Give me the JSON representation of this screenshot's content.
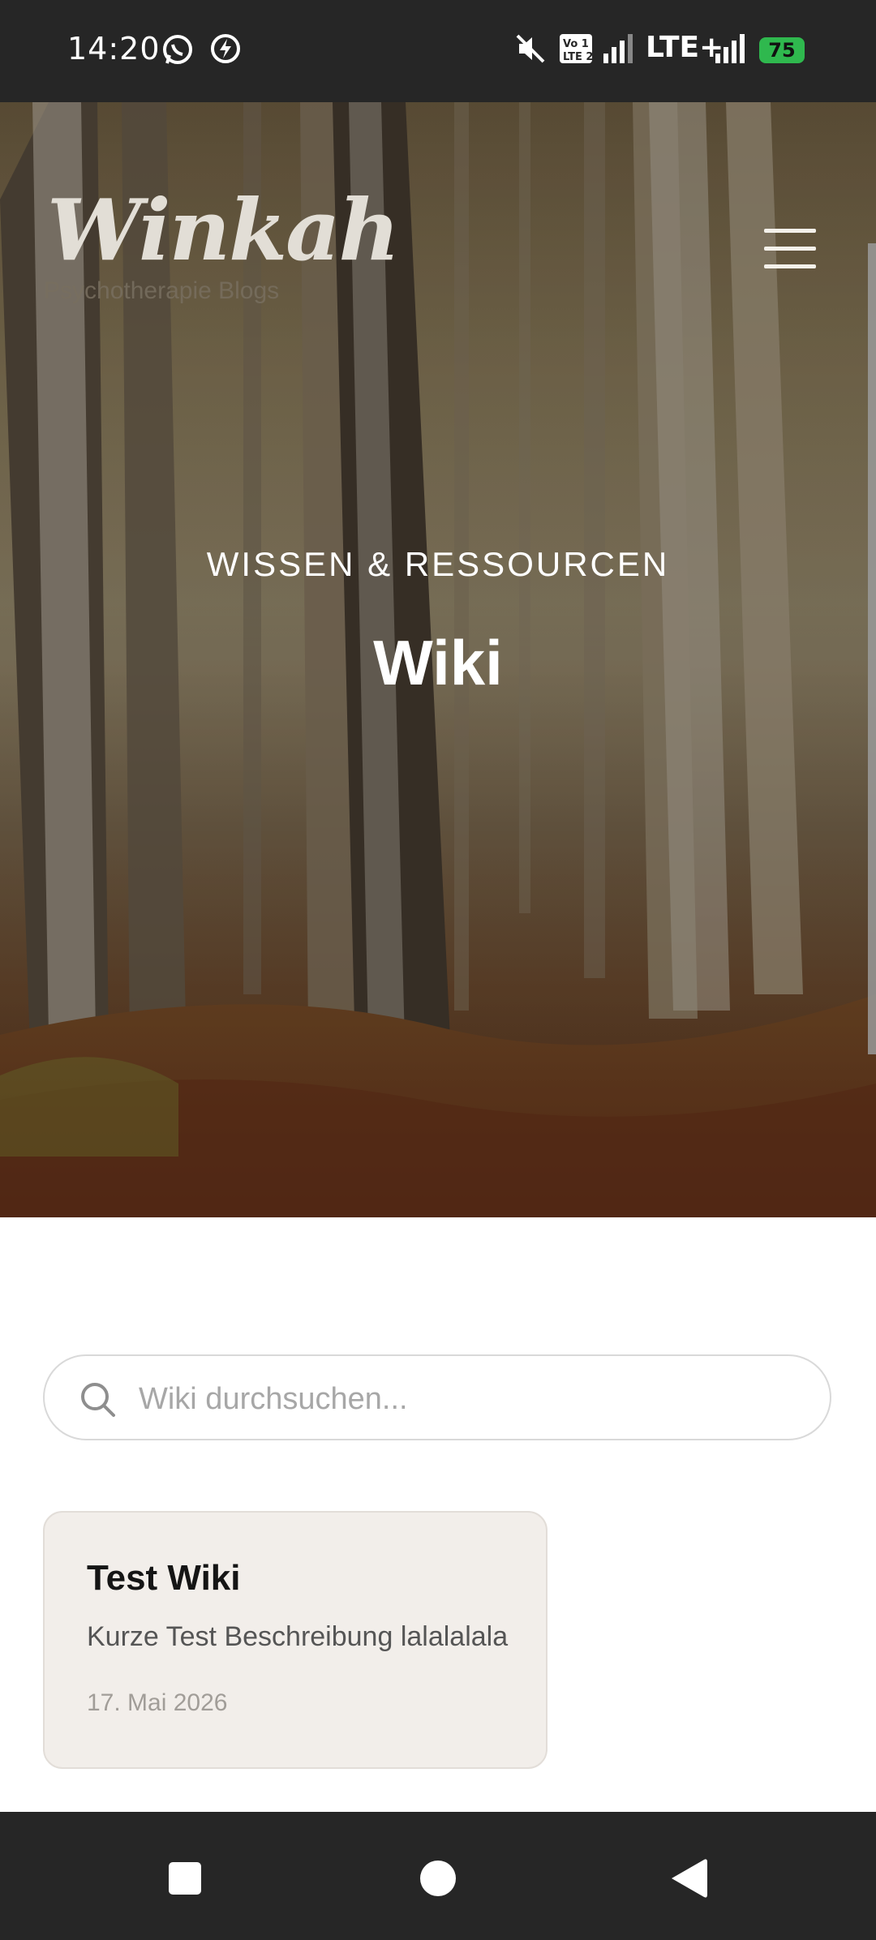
{
  "status_bar": {
    "time": "14:20",
    "network_label": "LTE+",
    "battery_level": "75",
    "icons": [
      "whatsapp-icon",
      "charging-bolt-icon",
      "mute-icon",
      "volte-icon",
      "signal-icon",
      "signal-icon"
    ]
  },
  "header": {
    "logo_text": "Winkah",
    "logo_subtitle": "Psychotherapie Blogs",
    "menu_icon": "hamburger-menu-icon"
  },
  "hero": {
    "eyebrow": "WISSEN & RESSOURCEN",
    "title": "Wiki"
  },
  "search": {
    "placeholder": "Wiki durchsuchen...",
    "value": ""
  },
  "wiki_entries": [
    {
      "title": "Test Wiki",
      "description": "Kurze Test Beschreibung lalalalala",
      "date": "17. Mai 2026"
    }
  ],
  "nav_bar": {
    "buttons": [
      "recents-square-icon",
      "home-circle-icon",
      "back-triangle-icon"
    ]
  },
  "colors": {
    "status_bar_bg": "#262626",
    "card_bg": "#f2eeea",
    "battery": "#2fb84e"
  }
}
